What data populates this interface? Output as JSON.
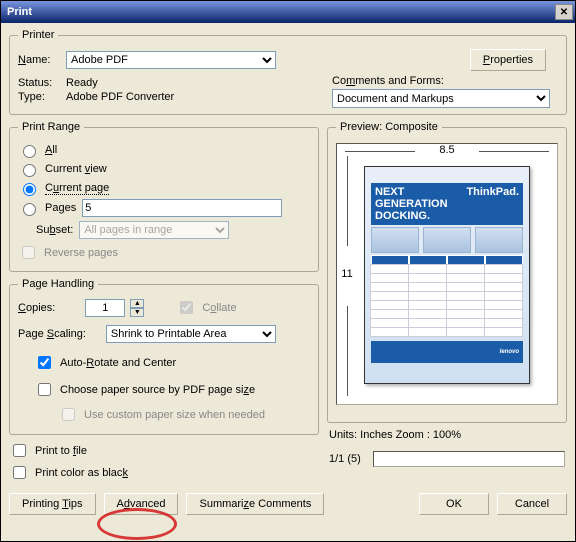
{
  "window": {
    "title": "Print"
  },
  "printer": {
    "legend": "Printer",
    "name_label": "Name:",
    "name_value": "Adobe PDF",
    "properties_btn": "Properties",
    "status_label": "Status:",
    "status_value": "Ready",
    "type_label": "Type:",
    "type_value": "Adobe PDF Converter",
    "comments_label": "Comments and Forms:",
    "comments_value": "Document and Markups"
  },
  "range": {
    "legend": "Print Range",
    "all": "All",
    "current_view": "Current view",
    "current_page": "Current page",
    "pages_label": "Pages",
    "pages_value": "5",
    "subset_label": "Subset:",
    "subset_value": "All pages in range",
    "reverse": "Reverse pages",
    "selected": "current_page"
  },
  "handling": {
    "legend": "Page Handling",
    "copies_label": "Copies:",
    "copies_value": "1",
    "collate": "Collate",
    "scaling_label": "Page Scaling:",
    "scaling_value": "Shrink to Printable Area",
    "auto_rotate": "Auto-Rotate and Center",
    "choose_source": "Choose paper source by PDF page size",
    "custom_paper": "Use custom paper size when needed"
  },
  "misc": {
    "print_to_file": "Print to file",
    "print_black": "Print color as black"
  },
  "preview": {
    "legend": "Preview: Composite",
    "width": "8.5",
    "height": "11",
    "doc_title": "NEXT GENERATION DOCKING.",
    "brand_tr": "ThinkPad.",
    "brand_br": "lenovo",
    "units": "Units: Inches Zoom : 100%",
    "pager": "1/1 (5)"
  },
  "footer": {
    "tips": "Printing Tips",
    "advanced": "Advanced",
    "summarize": "Summarize Comments",
    "ok": "OK",
    "cancel": "Cancel"
  }
}
